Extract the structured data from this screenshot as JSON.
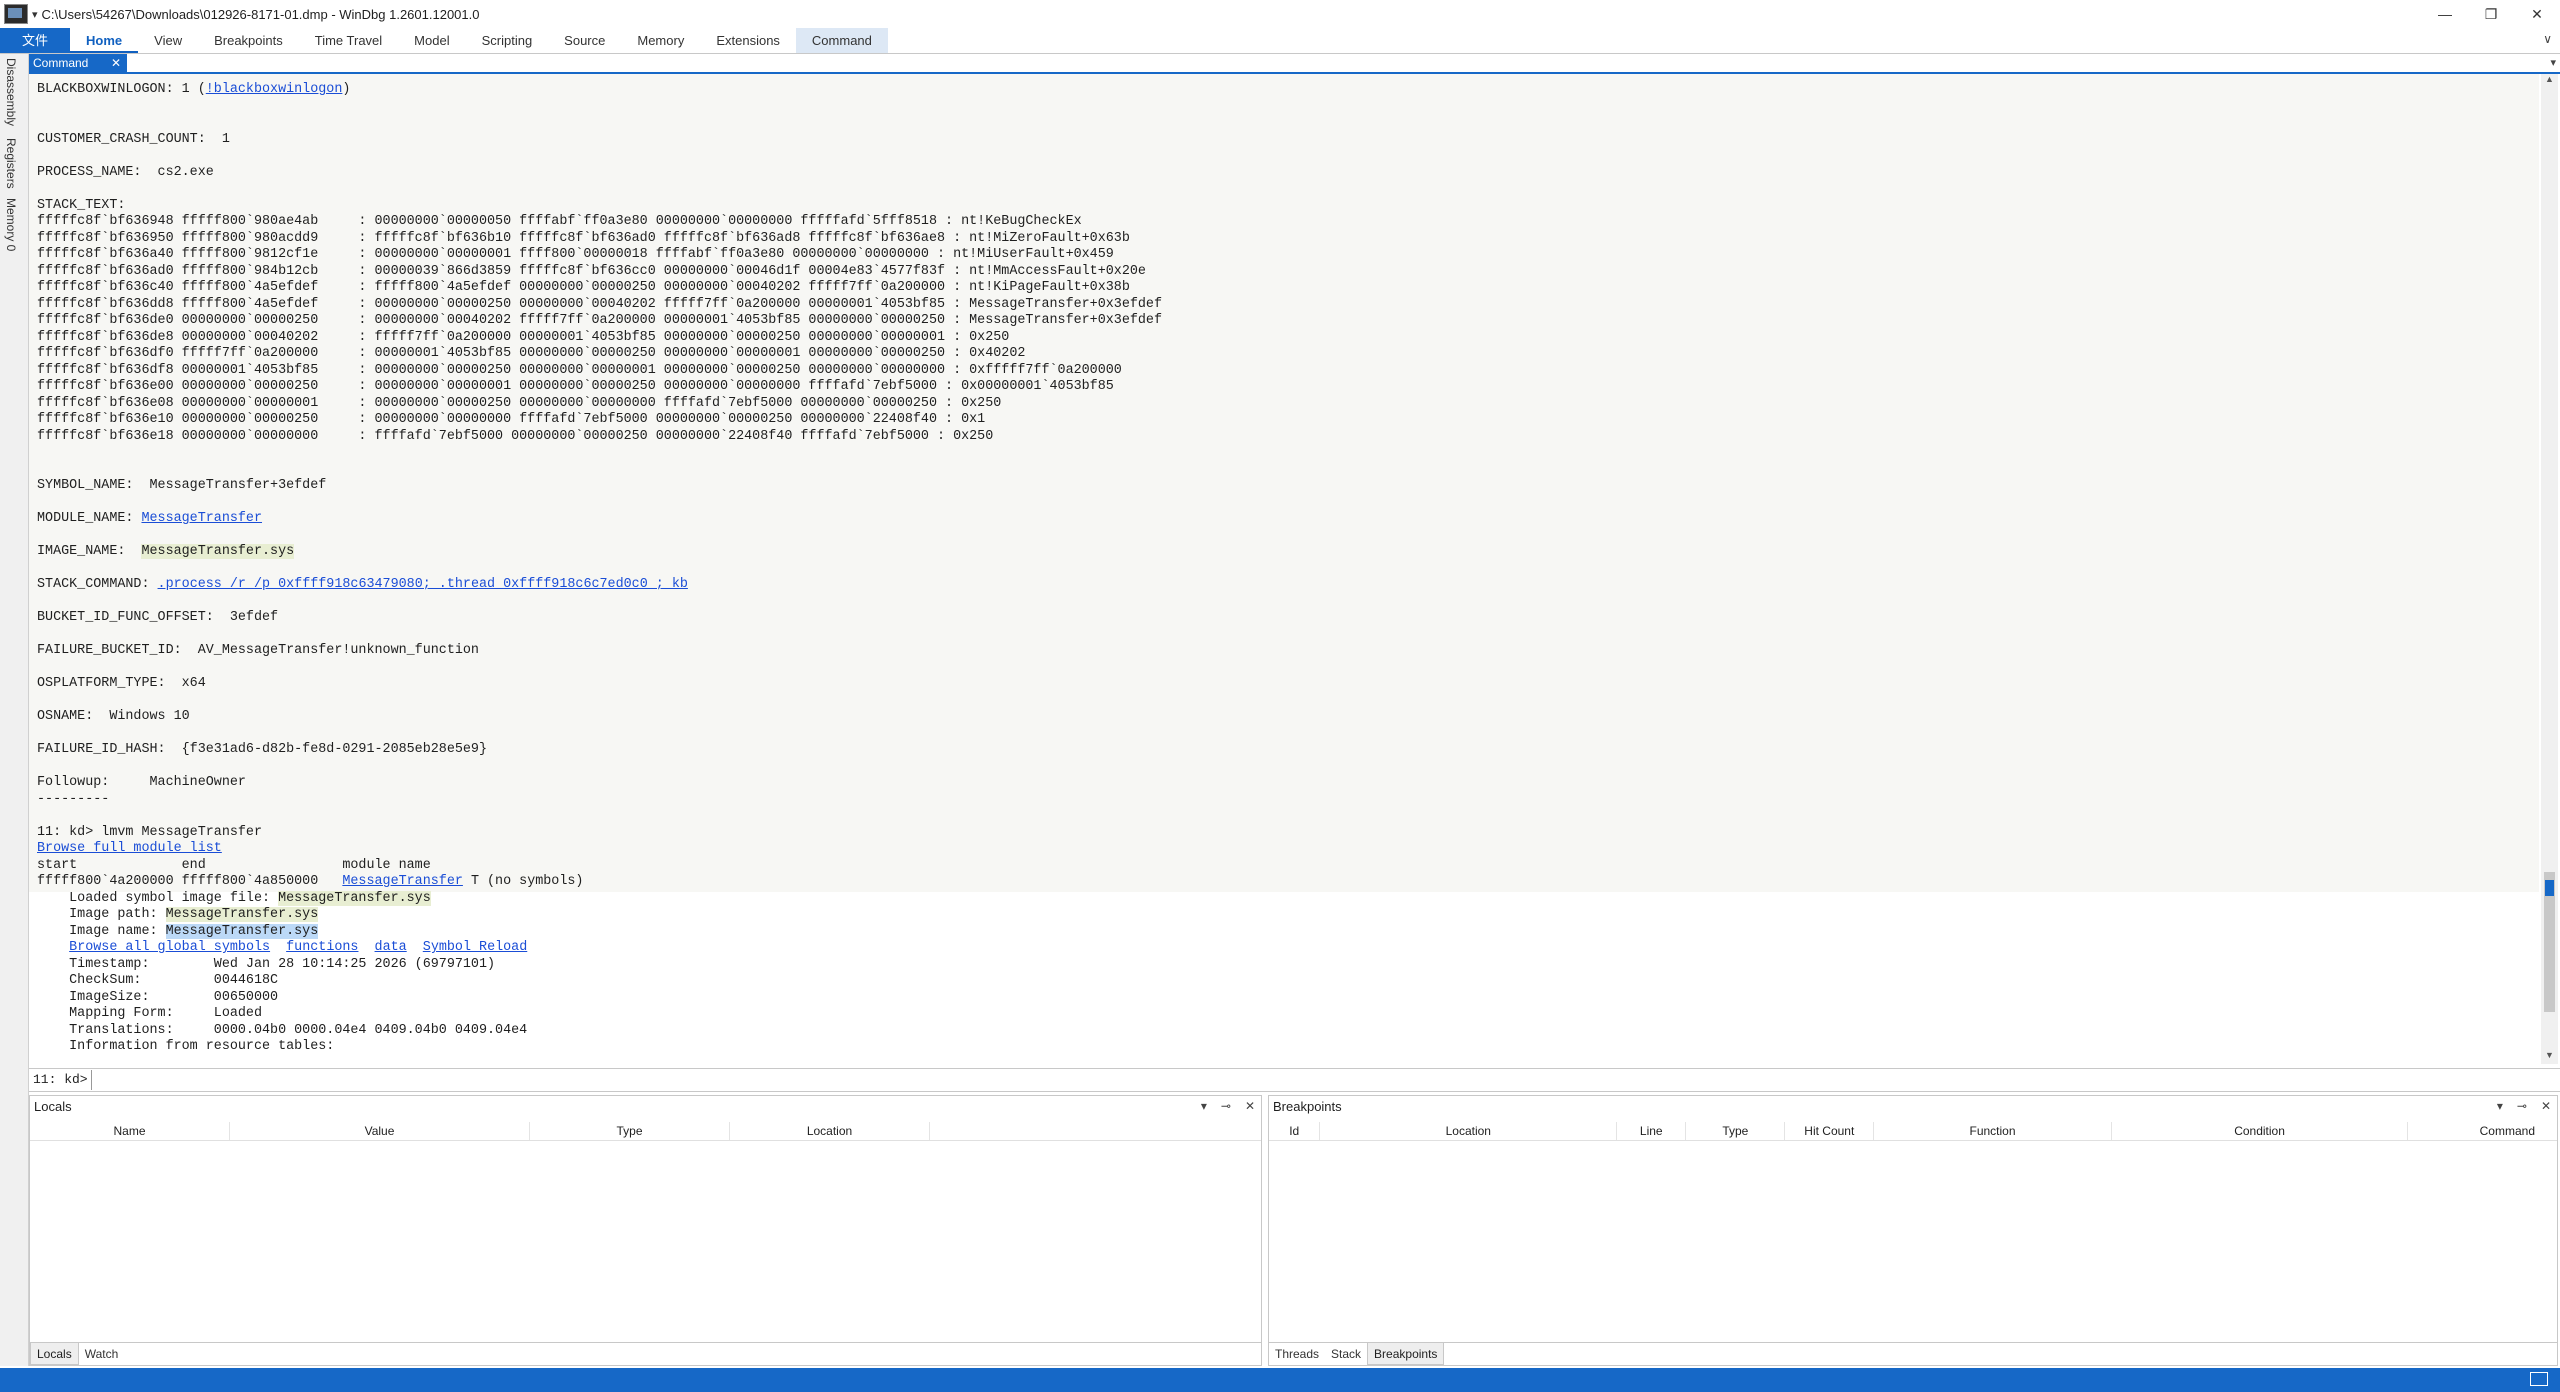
{
  "titlebar": {
    "title": "C:\\Users\\54267\\Downloads\\012926-8171-01.dmp - WinDbg 1.2601.12001.0",
    "dropdown": "▾",
    "minimize": "—",
    "restore": "❐",
    "close": "✕"
  },
  "ribbon": {
    "tabs": [
      "文件",
      "Home",
      "View",
      "Breakpoints",
      "Time Travel",
      "Model",
      "Scripting",
      "Source",
      "Memory",
      "Extensions",
      "Command"
    ],
    "collapse": "∨"
  },
  "side_tabs": [
    "Disassembly",
    "Registers",
    "Memory 0"
  ],
  "doc_tab": {
    "label": "Command",
    "close": "✕",
    "menu": "▾"
  },
  "output": {
    "lines": [
      [
        {
          "t": "BLACKBOXWINLOGON: 1 ("
        },
        {
          "t": "!blackboxwinlogon",
          "s": "lnk"
        },
        {
          "t": ")"
        }
      ],
      [
        {
          "t": ""
        }
      ],
      [
        {
          "t": ""
        }
      ],
      [
        {
          "t": "CUSTOMER_CRASH_COUNT:  1"
        }
      ],
      [
        {
          "t": ""
        }
      ],
      [
        {
          "t": "PROCESS_NAME:  cs2.exe"
        }
      ],
      [
        {
          "t": ""
        }
      ],
      [
        {
          "t": "STACK_TEXT:  "
        }
      ],
      [
        {
          "t": "fffffc8f`bf636948 fffff800`980ae4ab     : 00000000`00000050 ffffabf`ff0a3e80 00000000`00000000 fffffafd`5fff8518 : nt!KeBugCheckEx"
        }
      ],
      [
        {
          "t": "fffffc8f`bf636950 fffff800`980acdd9     : fffffc8f`bf636b10 fffffc8f`bf636ad0 fffffc8f`bf636ad8 fffffc8f`bf636ae8 : nt!MiZeroFault+0x63b"
        }
      ],
      [
        {
          "t": "fffffc8f`bf636a40 fffff800`9812cf1e     : 00000000`00000001 ffff800`00000018 ffffabf`ff0a3e80 00000000`00000000 : nt!MiUserFault+0x459"
        }
      ],
      [
        {
          "t": "fffffc8f`bf636ad0 fffff800`984b12cb     : 00000039`866d3859 fffffc8f`bf636cc0 00000000`00046d1f 00004e83`4577f83f : nt!MmAccessFault+0x20e"
        }
      ],
      [
        {
          "t": "fffffc8f`bf636c40 fffff800`4a5efdef     : fffff800`4a5efdef 00000000`00000250 00000000`00040202 fffff7ff`0a200000 : nt!KiPageFault+0x38b"
        }
      ],
      [
        {
          "t": "fffffc8f`bf636dd8 fffff800`4a5efdef     : 00000000`00000250 00000000`00040202 fffff7ff`0a200000 00000001`4053bf85 : MessageTransfer+0x3efdef"
        }
      ],
      [
        {
          "t": "fffffc8f`bf636de0 00000000`00000250     : 00000000`00040202 fffff7ff`0a200000 00000001`4053bf85 00000000`00000250 : MessageTransfer+0x3efdef"
        }
      ],
      [
        {
          "t": "fffffc8f`bf636de8 00000000`00040202     : fffff7ff`0a200000 00000001`4053bf85 00000000`00000250 00000000`00000001 : 0x250"
        }
      ],
      [
        {
          "t": "fffffc8f`bf636df0 fffff7ff`0a200000     : 00000001`4053bf85 00000000`00000250 00000000`00000001 00000000`00000250 : 0x40202"
        }
      ],
      [
        {
          "t": "fffffc8f`bf636df8 00000001`4053bf85     : 00000000`00000250 00000000`00000001 00000000`00000250 00000000`00000000 : 0xfffff7ff`0a200000"
        }
      ],
      [
        {
          "t": "fffffc8f`bf636e00 00000000`00000250     : 00000000`00000001 00000000`00000250 00000000`00000000 ffffafd`7ebf5000 : 0x00000001`4053bf85"
        }
      ],
      [
        {
          "t": "fffffc8f`bf636e08 00000000`00000001     : 00000000`00000250 00000000`00000000 ffffafd`7ebf5000 00000000`00000250 : 0x250"
        }
      ],
      [
        {
          "t": "fffffc8f`bf636e10 00000000`00000250     : 00000000`00000000 ffffafd`7ebf5000 00000000`00000250 00000000`22408f40 : 0x1"
        }
      ],
      [
        {
          "t": "fffffc8f`bf636e18 00000000`00000000     : ffffafd`7ebf5000 00000000`00000250 00000000`22408f40 ffffafd`7ebf5000 : 0x250"
        }
      ],
      [
        {
          "t": ""
        }
      ],
      [
        {
          "t": ""
        }
      ],
      [
        {
          "t": "SYMBOL_NAME:  MessageTransfer+3efdef"
        }
      ],
      [
        {
          "t": ""
        }
      ],
      [
        {
          "t": "MODULE_NAME: "
        },
        {
          "t": "MessageTransfer",
          "s": "lnk"
        }
      ],
      [
        {
          "t": ""
        }
      ],
      [
        {
          "t": "IMAGE_NAME:  "
        },
        {
          "t": "MessageTransfer.sys",
          "s": "hl"
        }
      ],
      [
        {
          "t": ""
        }
      ],
      [
        {
          "t": "STACK_COMMAND: "
        },
        {
          "t": ".process /r /p 0xffff918c63479080; .thread 0xffff918c6c7ed0c0 ; kb",
          "s": "lnk"
        }
      ],
      [
        {
          "t": ""
        }
      ],
      [
        {
          "t": "BUCKET_ID_FUNC_OFFSET:  3efdef"
        }
      ],
      [
        {
          "t": ""
        }
      ],
      [
        {
          "t": "FAILURE_BUCKET_ID:  AV_MessageTransfer!unknown_function"
        }
      ],
      [
        {
          "t": ""
        }
      ],
      [
        {
          "t": "OSPLATFORM_TYPE:  x64"
        }
      ],
      [
        {
          "t": ""
        }
      ],
      [
        {
          "t": "OSNAME:  Windows 10"
        }
      ],
      [
        {
          "t": ""
        }
      ],
      [
        {
          "t": "FAILURE_ID_HASH:  {f3e31ad6-d82b-fe8d-0291-2085eb28e5e9}"
        }
      ],
      [
        {
          "t": ""
        }
      ],
      [
        {
          "t": "Followup:     MachineOwner"
        }
      ],
      [
        {
          "t": "---------"
        }
      ],
      [
        {
          "t": ""
        }
      ],
      [
        {
          "t": "11: kd> lmvm MessageTransfer"
        }
      ],
      [
        {
          "t": "Browse full module list",
          "s": "lnk"
        }
      ],
      [
        {
          "t": "start             end                 module name"
        }
      ],
      [
        {
          "t": "fffff800`4a200000 fffff800`4a850000   "
        },
        {
          "t": "MessageTransfer",
          "s": "lnk"
        },
        {
          "t": " T (no symbols)"
        }
      ],
      [
        {
          "t": "    Loaded symbol image file: "
        },
        {
          "t": "MessageTransfer.sys",
          "s": "hl"
        }
      ],
      [
        {
          "t": "    Image path: "
        },
        {
          "t": "MessageTransfer.sys",
          "s": "hl"
        }
      ],
      [
        {
          "t": "    Image name: "
        },
        {
          "t": "MessageTransfer.sys",
          "s": "hlsel"
        }
      ],
      [
        {
          "t": "    "
        },
        {
          "t": "Browse all global symbols",
          "s": "lnk"
        },
        {
          "t": "  "
        },
        {
          "t": "functions",
          "s": "lnk"
        },
        {
          "t": "  "
        },
        {
          "t": "data",
          "s": "lnk"
        },
        {
          "t": "  "
        },
        {
          "t": "Symbol Reload",
          "s": "lnk"
        }
      ],
      [
        {
          "t": "    Timestamp:        Wed Jan 28 10:14:25 2026 (69797101)"
        }
      ],
      [
        {
          "t": "    CheckSum:         0044618C"
        }
      ],
      [
        {
          "t": "    ImageSize:        00650000"
        }
      ],
      [
        {
          "t": "    Mapping Form:     Loaded"
        }
      ],
      [
        {
          "t": "    Translations:     0000.04b0 0000.04e4 0409.04b0 0409.04e4"
        }
      ],
      [
        {
          "t": "    Information from resource tables:"
        }
      ]
    ]
  },
  "command": {
    "prompt": "11: kd>",
    "value": ""
  },
  "locals_pane": {
    "title": "Locals",
    "columns": [
      "Name",
      "Value",
      "Type",
      "Location"
    ],
    "tabs": [
      "Locals",
      "Watch"
    ]
  },
  "breakpoints_pane": {
    "title": "Breakpoints",
    "columns": [
      "Id",
      "Location",
      "Line",
      "Type",
      "Hit Count",
      "Function",
      "Condition",
      "Command"
    ],
    "tabs": [
      "Threads",
      "Stack",
      "Breakpoints"
    ]
  },
  "pane_controls": {
    "dropdown": "▾",
    "pin": "⊸",
    "close": "✕"
  },
  "colors": {
    "accent": "#1668c7",
    "link": "#1a4dd6",
    "highlight": "#e8eed2",
    "selection": "#bcd9f7"
  }
}
